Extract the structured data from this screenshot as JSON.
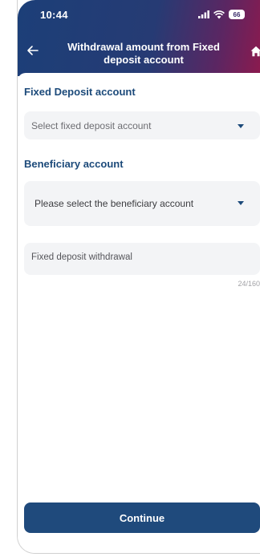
{
  "status_bar": {
    "time": "10:44",
    "battery": "66"
  },
  "header": {
    "title_line1": "Withdrawal amount from Fixed",
    "title_line2": "deposit account"
  },
  "fixed_deposit": {
    "label": "Fixed Deposit account",
    "placeholder": "Select fixed deposit account"
  },
  "beneficiary": {
    "label": "Beneficiary account",
    "placeholder": "Please select the beneficiary account"
  },
  "description": {
    "value": "Fixed deposit withdrawal",
    "char_count": "24/160"
  },
  "continue_label": "Continue",
  "colors": {
    "header_start": "#1c3f78",
    "header_end": "#8c1a4e",
    "accent": "#1c4a7a",
    "button": "#1f4a7c",
    "field_bg": "#f3f4f6"
  },
  "icons": [
    "back-arrow-icon",
    "home-icon",
    "signal-icon",
    "wifi-icon",
    "battery-icon",
    "chevron-down-icon"
  ]
}
